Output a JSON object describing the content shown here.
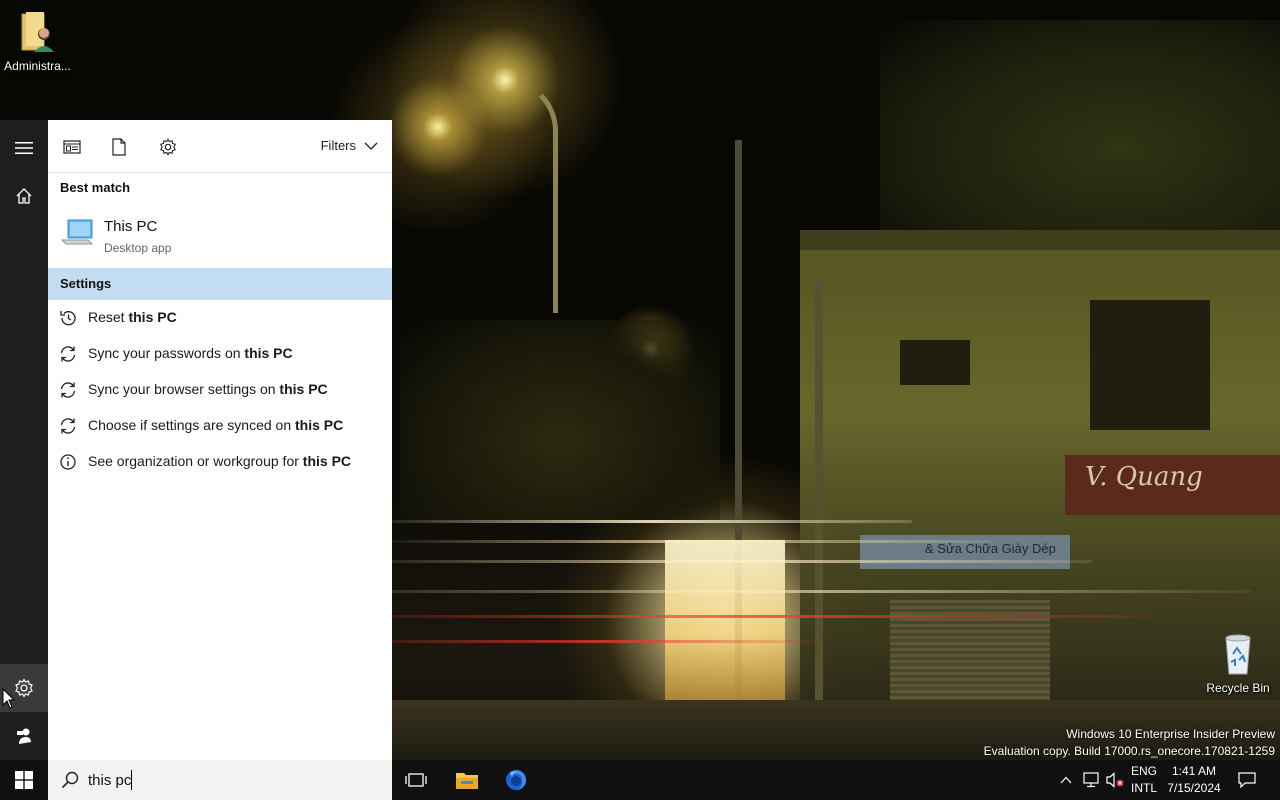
{
  "desktop": {
    "icons": [
      {
        "label": "Administra..."
      },
      {
        "label": "Recycle Bin"
      }
    ],
    "watermark": {
      "line1": "Windows 10 Enterprise Insider Preview",
      "line2": "Evaluation copy. Build 17000.rs_onecore.170821-1259"
    },
    "wallpaper_signs": {
      "shop_banner": "V. Quang",
      "shop_sign": "& Sửa Chữa Giày Dép"
    }
  },
  "start_rail": {
    "items": [
      {
        "icon": "hamburger-menu-icon"
      },
      {
        "icon": "home-icon"
      },
      {
        "icon": "gear-icon"
      },
      {
        "icon": "feedback-icon"
      }
    ]
  },
  "search_panel": {
    "toolbar": {
      "filters_label": "Filters",
      "icons": [
        "apps-filter-icon",
        "documents-filter-icon",
        "settings-filter-icon"
      ]
    },
    "best_match": {
      "heading": "Best match",
      "title": "This PC",
      "subtitle": "Desktop app",
      "icon": "this-pc-icon"
    },
    "settings": {
      "heading": "Settings",
      "results": [
        {
          "prefix": "Reset ",
          "match": "this PC",
          "icon": "history-icon"
        },
        {
          "prefix": "Sync your passwords on ",
          "match": "this PC",
          "icon": "sync-icon"
        },
        {
          "prefix": "Sync your browser settings on ",
          "match": "this PC",
          "icon": "sync-icon"
        },
        {
          "prefix": "Choose if settings are synced on ",
          "match": "this PC",
          "icon": "sync-icon"
        },
        {
          "prefix": "See organization or workgroup for ",
          "match": "this PC",
          "icon": "info-icon"
        }
      ]
    }
  },
  "taskbar": {
    "search": {
      "value": "this pc",
      "placeholder": ""
    },
    "apps": [
      "task-view-icon",
      "file-explorer-icon",
      "firefox-icon"
    ],
    "tray": {
      "lang_line1": "ENG",
      "lang_line2": "INTL",
      "time": "1:41 AM",
      "date": "7/15/2024"
    }
  },
  "colors": {
    "selection_highlight": "#c2dcf2",
    "rail_bg": "#1f1f1f",
    "taskbar_bg": "#101010"
  }
}
